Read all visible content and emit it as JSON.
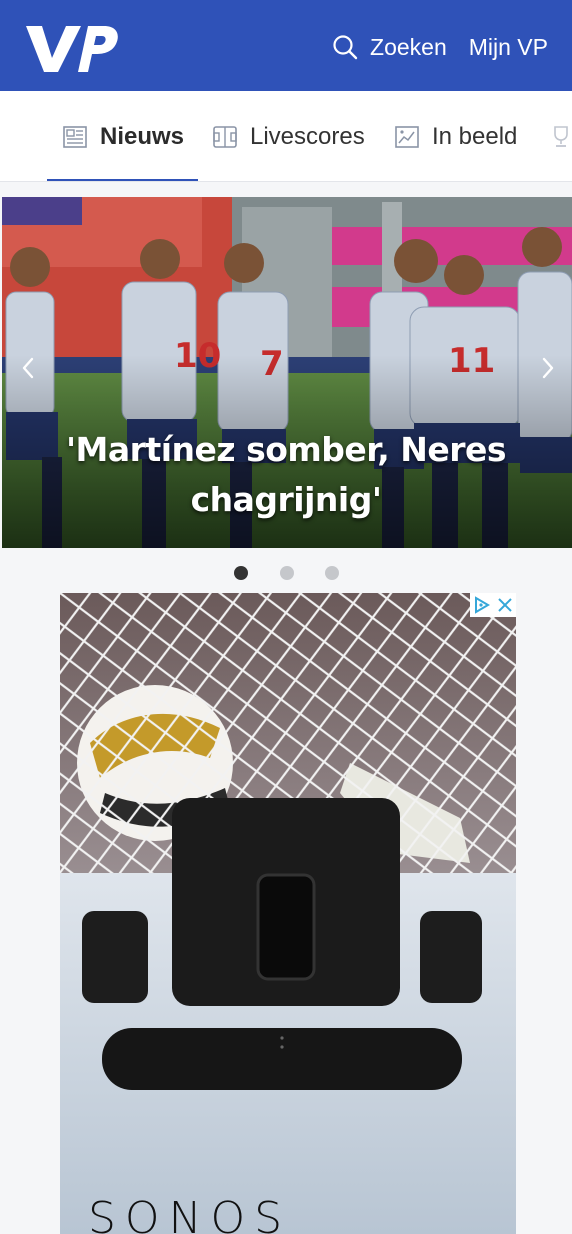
{
  "header": {
    "logo_text": "VP",
    "search_label": "Zoeken",
    "account_label": "Mijn VP",
    "background_color": "#2f52b8"
  },
  "tabs": [
    {
      "label": "Nieuws",
      "icon": "newspaper-icon",
      "active": true
    },
    {
      "label": "Livescores",
      "icon": "field-icon",
      "active": false
    },
    {
      "label": "In beeld",
      "icon": "image-icon",
      "active": false
    },
    {
      "label": "",
      "icon": "trophy-icon",
      "active": false
    }
  ],
  "carousel": {
    "headline_line1": "'Martínez somber, Neres",
    "headline_line2": "chagrijnig'",
    "active_slide": 1,
    "slide_count": 3
  },
  "ad": {
    "brand": "SONOS",
    "choices_icons": [
      "adchoices-icon",
      "close-icon"
    ]
  },
  "colors": {
    "accent": "#2f52b8",
    "dot_active": "#333333",
    "dot_inactive": "#c5c7cb"
  }
}
